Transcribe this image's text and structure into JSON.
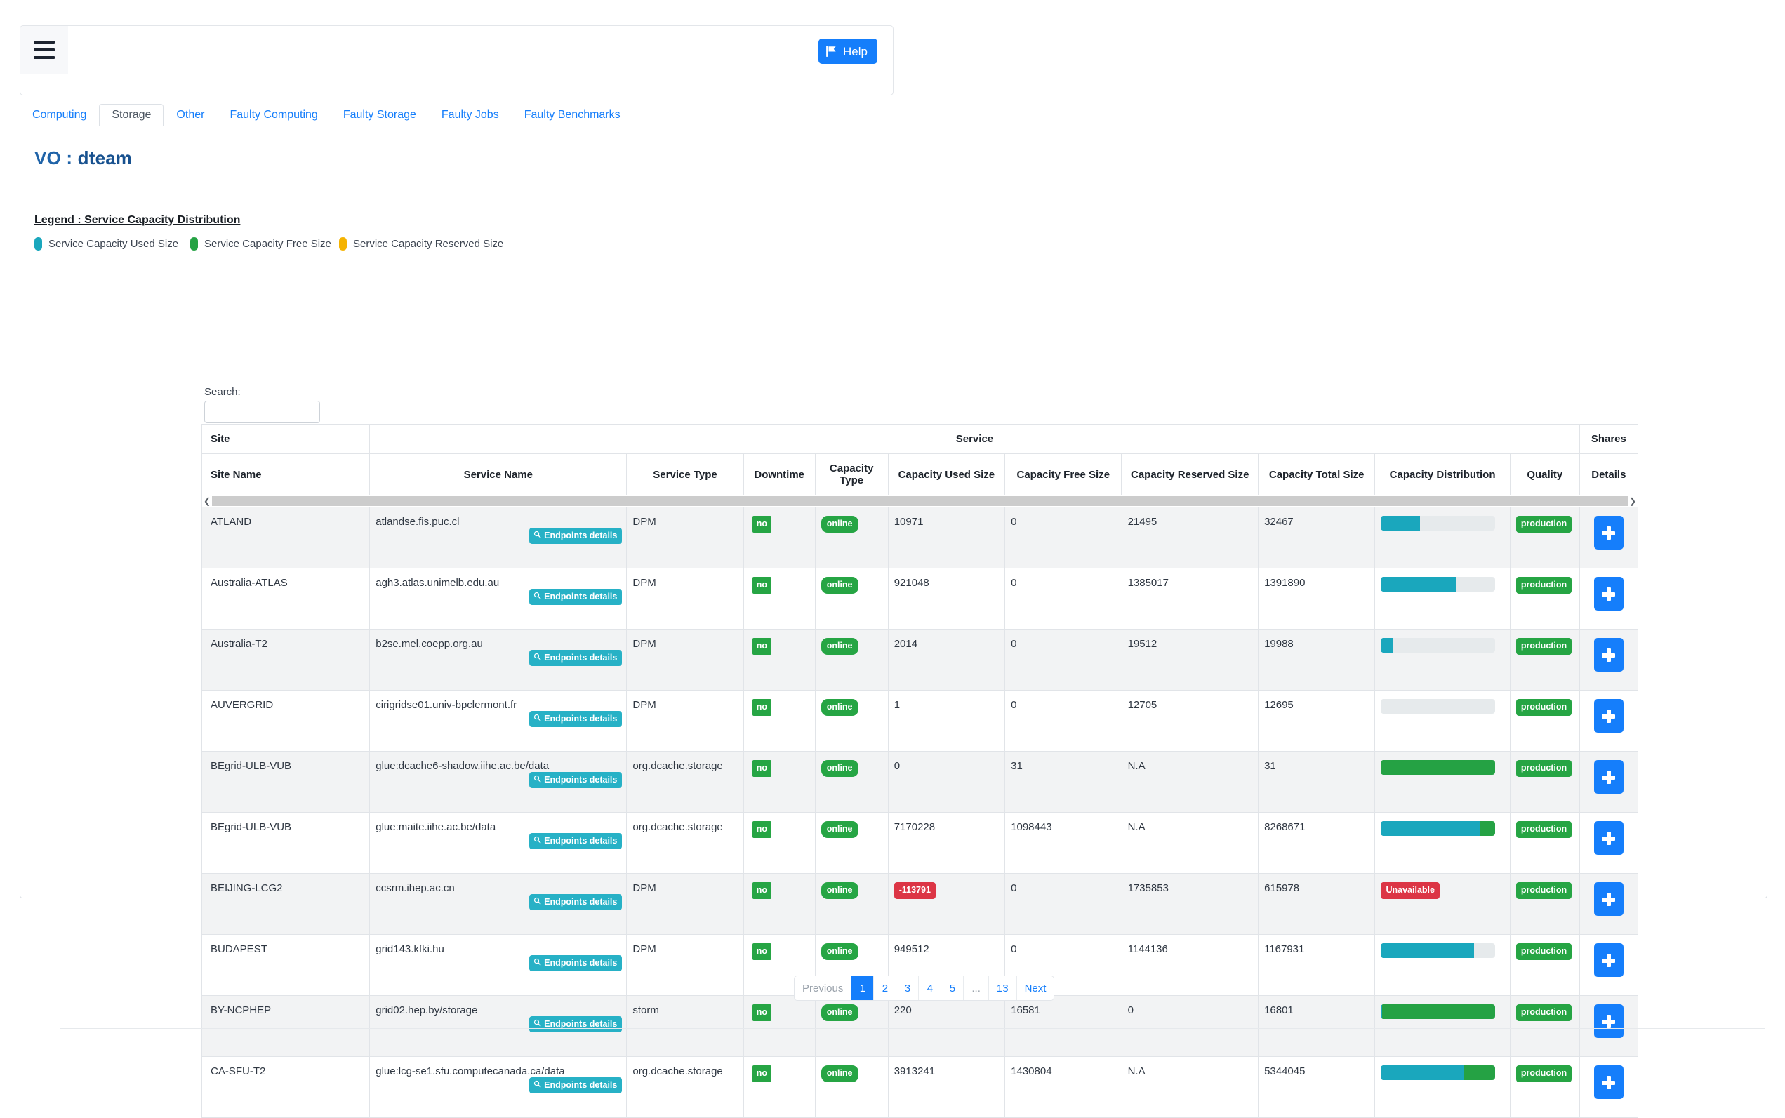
{
  "navbar": {
    "menu_icon": "hamburger-icon",
    "help_label": "Help",
    "help_icon": "flag-icon"
  },
  "tabs": [
    {
      "label": "Computing",
      "active": false
    },
    {
      "label": "Storage",
      "active": true
    },
    {
      "label": "Other",
      "active": false
    },
    {
      "label": "Faulty Computing",
      "active": false
    },
    {
      "label": "Faulty Storage",
      "active": false
    },
    {
      "label": "Faulty Jobs",
      "active": false
    },
    {
      "label": "Faulty Benchmarks",
      "active": false
    }
  ],
  "page": {
    "title_prefix": "VO : ",
    "vo_name": "dteam"
  },
  "legend": {
    "title": "Legend : Service Capacity Distribution",
    "items": [
      {
        "label": "Service Capacity Used Size",
        "color": "#1aa7bd"
      },
      {
        "label": "Service Capacity Free Size",
        "color": "#25a244"
      },
      {
        "label": "Service Capacity Reserved Size",
        "color": "#f5b301"
      }
    ]
  },
  "search": {
    "label": "Search:",
    "value": "",
    "placeholder": ""
  },
  "table": {
    "group_headers": {
      "site": "Site",
      "service": "Service",
      "shares": "Shares"
    },
    "columns": [
      "Site Name",
      "Service Name",
      "Service Type",
      "Downtime",
      "Capacity Type",
      "Capacity Used Size",
      "Capacity Free Size",
      "Capacity Reserved Size",
      "Capacity Total Size",
      "Capacity Distribution",
      "Quality",
      "Details"
    ],
    "endpoints_button_label": "Endpoints details",
    "scroll_left_icon": "chevron-left-icon",
    "scroll_right_icon": "chevron-right-icon",
    "rows": [
      {
        "site_name": "ATLAND",
        "service_name": "atlandse.fis.puc.cl",
        "service_type": "DPM",
        "downtime": "no",
        "capacity_type": "online",
        "used": "10971",
        "free": "0",
        "reserved": "21495",
        "total": "32467",
        "distribution": {
          "unavailable": false,
          "used_pct": 34,
          "free_pct": 0,
          "reserved_pct": 0
        },
        "quality": "production"
      },
      {
        "site_name": "Australia-ATLAS",
        "service_name": "agh3.atlas.unimelb.edu.au",
        "service_type": "DPM",
        "downtime": "no",
        "capacity_type": "online",
        "used": "921048",
        "free": "0",
        "reserved": "1385017",
        "total": "1391890",
        "distribution": {
          "unavailable": false,
          "used_pct": 66,
          "free_pct": 0,
          "reserved_pct": 0
        },
        "quality": "production"
      },
      {
        "site_name": "Australia-T2",
        "service_name": "b2se.mel.coepp.org.au",
        "service_type": "DPM",
        "downtime": "no",
        "capacity_type": "online",
        "used": "2014",
        "free": "0",
        "reserved": "19512",
        "total": "19988",
        "distribution": {
          "unavailable": false,
          "used_pct": 10,
          "free_pct": 0,
          "reserved_pct": 0
        },
        "quality": "production"
      },
      {
        "site_name": "AUVERGRID",
        "service_name": "cirigridse01.univ-bpclermont.fr",
        "service_type": "DPM",
        "downtime": "no",
        "capacity_type": "online",
        "used": "1",
        "free": "0",
        "reserved": "12705",
        "total": "12695",
        "distribution": {
          "unavailable": false,
          "used_pct": 0,
          "free_pct": 0,
          "reserved_pct": 0
        },
        "quality": "production"
      },
      {
        "site_name": "BEgrid-ULB-VUB",
        "service_name": "glue:dcache6-shadow.iihe.ac.be/data",
        "service_type": "org.dcache.storage",
        "downtime": "no",
        "capacity_type": "online",
        "used": "0",
        "free": "31",
        "reserved": "N.A",
        "total": "31",
        "distribution": {
          "unavailable": false,
          "used_pct": 0,
          "free_pct": 100,
          "reserved_pct": 0
        },
        "quality": "production"
      },
      {
        "site_name": "BEgrid-ULB-VUB",
        "service_name": "glue:maite.iihe.ac.be/data",
        "service_type": "org.dcache.storage",
        "downtime": "no",
        "capacity_type": "online",
        "used": "7170228",
        "free": "1098443",
        "reserved": "N.A",
        "total": "8268671",
        "distribution": {
          "unavailable": false,
          "used_pct": 87,
          "free_pct": 13,
          "reserved_pct": 0
        },
        "quality": "production"
      },
      {
        "site_name": "BEIJING-LCG2",
        "service_name": "ccsrm.ihep.ac.cn",
        "service_type": "DPM",
        "downtime": "no",
        "capacity_type": "online",
        "used": "-113791",
        "used_is_negative": true,
        "free": "0",
        "reserved": "1735853",
        "total": "615978",
        "distribution": {
          "unavailable": true,
          "unavailable_label": "Unavailable"
        },
        "quality": "production"
      },
      {
        "site_name": "BUDAPEST",
        "service_name": "grid143.kfki.hu",
        "service_type": "DPM",
        "downtime": "no",
        "capacity_type": "online",
        "used": "949512",
        "free": "0",
        "reserved": "1144136",
        "total": "1167931",
        "distribution": {
          "unavailable": false,
          "used_pct": 81,
          "free_pct": 0,
          "reserved_pct": 0
        },
        "quality": "production"
      },
      {
        "site_name": "BY-NCPHEP",
        "service_name": "grid02.hep.by/storage",
        "service_type": "storm",
        "downtime": "no",
        "capacity_type": "online",
        "used": "220",
        "free": "16581",
        "reserved": "0",
        "total": "16801",
        "distribution": {
          "unavailable": false,
          "used_pct": 1,
          "free_pct": 99,
          "reserved_pct": 0
        },
        "quality": "production"
      },
      {
        "site_name": "CA-SFU-T2",
        "service_name": "glue:lcg-se1.sfu.computecanada.ca/data",
        "service_type": "org.dcache.storage",
        "downtime": "no",
        "capacity_type": "online",
        "used": "3913241",
        "free": "1430804",
        "reserved": "N.A",
        "total": "5344045",
        "distribution": {
          "unavailable": false,
          "used_pct": 73,
          "free_pct": 27,
          "reserved_pct": 0
        },
        "quality": "production"
      }
    ]
  },
  "pagination": {
    "previous_label": "Previous",
    "next_label": "Next",
    "pages": [
      "1",
      "2",
      "3",
      "4",
      "5",
      "...",
      "13"
    ],
    "active_page": "1"
  },
  "colors": {
    "primary": "#157efb",
    "teal": "#27b1c6",
    "green": "#26a544",
    "danger": "#dc3545",
    "used": "#1aa7bd",
    "free": "#25a244",
    "reserved": "#f5b301"
  }
}
